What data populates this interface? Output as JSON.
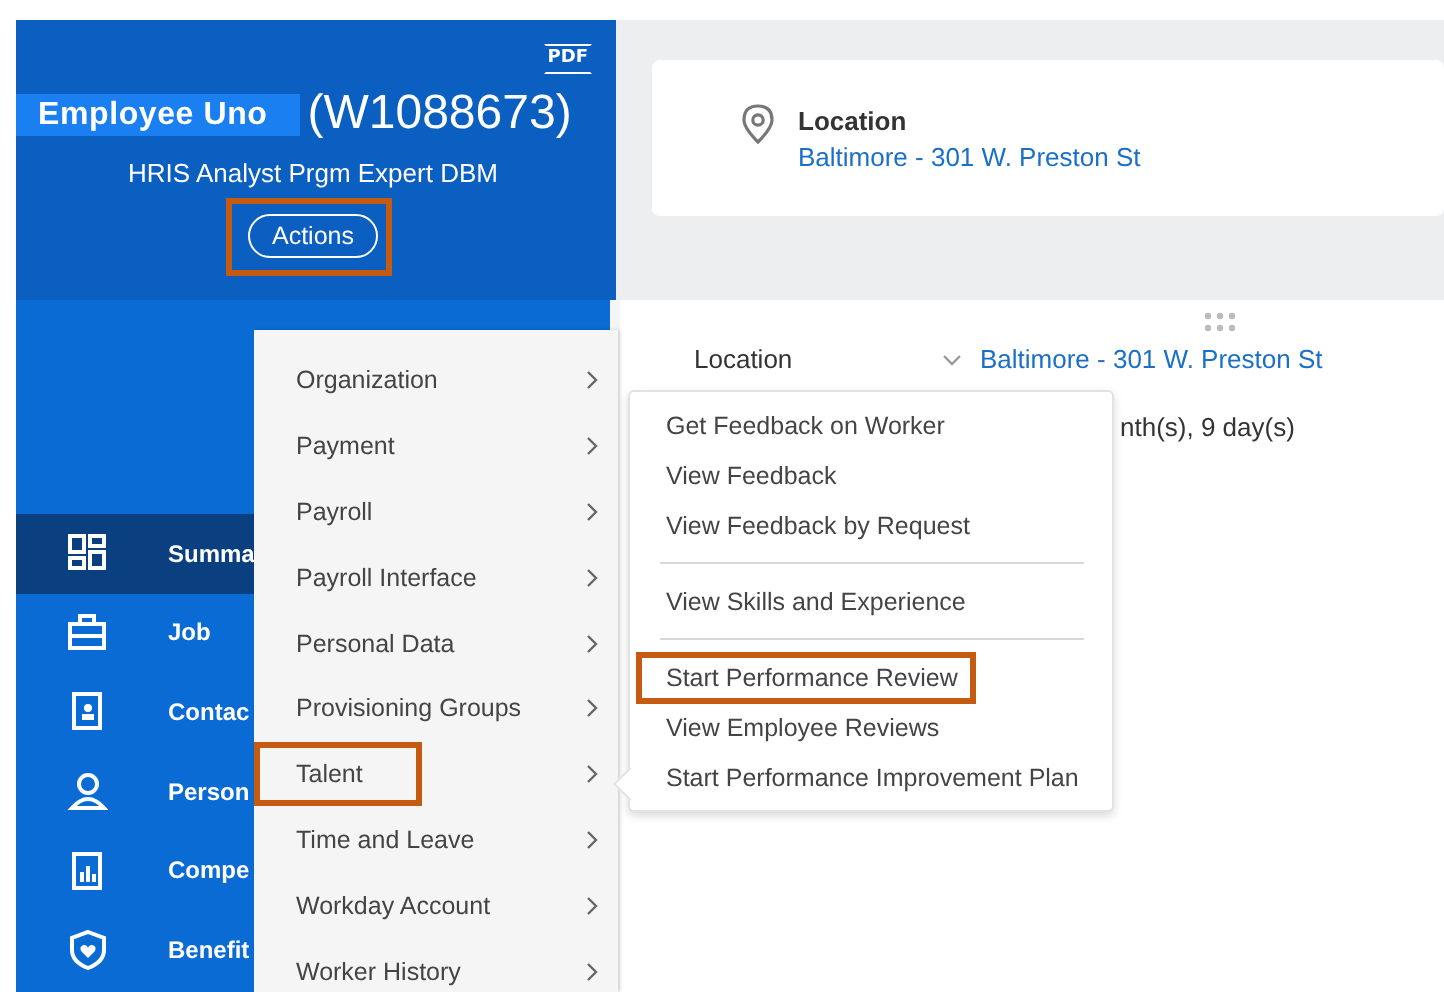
{
  "header": {
    "pdf_button": "PDF",
    "name": "Employee Uno",
    "worker_id": "(W1088673)",
    "job_title": "HRIS Analyst Prgm Expert DBM",
    "actions_button": {
      "label": "Actions",
      "highlighted": true
    }
  },
  "nav": [
    {
      "label": "Summa",
      "selected": true
    },
    {
      "label": "Job",
      "selected": false
    },
    {
      "label": "Contac",
      "selected": false
    },
    {
      "label": "Person",
      "selected": false
    },
    {
      "label": "Compe",
      "selected": false
    },
    {
      "label": "Benefit",
      "selected": false
    }
  ],
  "location_card": {
    "label": "Location",
    "value": "Baltimore - 301 W. Preston St"
  },
  "details": {
    "label": "Location",
    "value": "Baltimore - 301 W. Preston St",
    "tenure_fragment": "nth(s), 9 day(s)"
  },
  "actions_menu": [
    {
      "label": "Organization",
      "highlighted": false
    },
    {
      "label": "Payment",
      "highlighted": false
    },
    {
      "label": "Payroll",
      "highlighted": false
    },
    {
      "label": "Payroll Interface",
      "highlighted": false
    },
    {
      "label": "Personal Data",
      "highlighted": false
    },
    {
      "label": "Provisioning Groups",
      "highlighted": false
    },
    {
      "label": "Talent",
      "highlighted": true
    },
    {
      "label": "Time and Leave",
      "highlighted": false
    },
    {
      "label": "Workday Account",
      "highlighted": false
    },
    {
      "label": "Worker History",
      "highlighted": false
    }
  ],
  "talent_submenu": [
    [
      {
        "label": "Get Feedback on Worker",
        "highlighted": false
      },
      {
        "label": "View Feedback",
        "highlighted": false
      },
      {
        "label": "View Feedback by Request",
        "highlighted": false
      }
    ],
    [
      {
        "label": "View Skills and Experience",
        "highlighted": false
      }
    ],
    [
      {
        "label": "Start Performance Review",
        "highlighted": true
      },
      {
        "label": "View Employee Reviews",
        "highlighted": false
      },
      {
        "label": "Start Performance Improvement Plan",
        "highlighted": false
      }
    ]
  ]
}
